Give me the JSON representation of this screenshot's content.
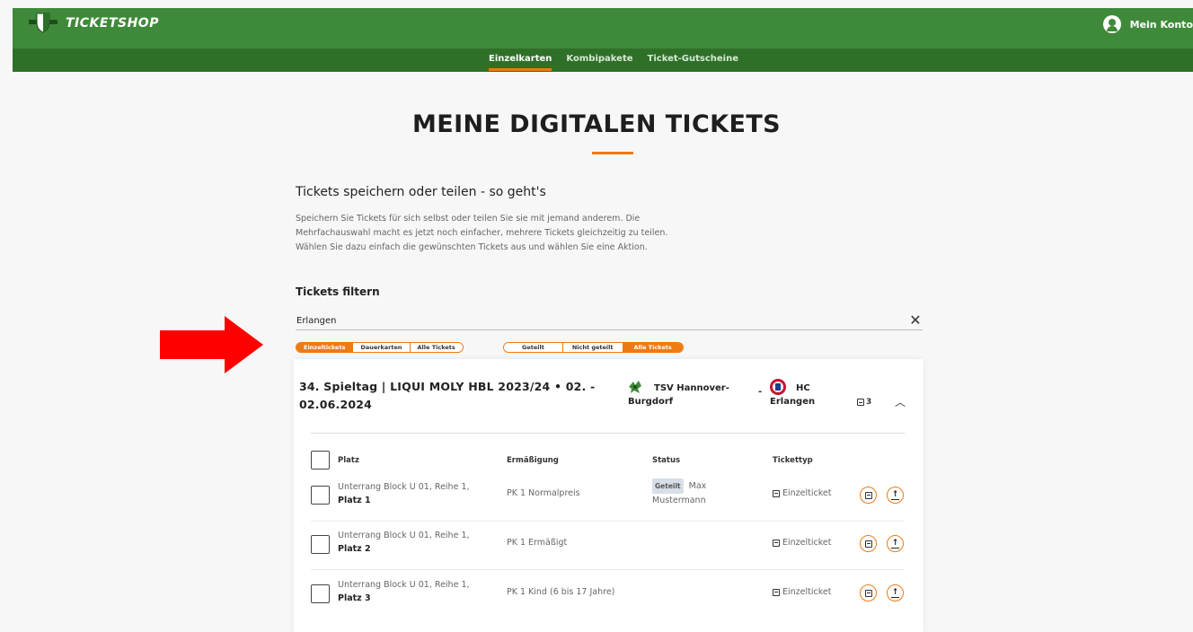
{
  "header": {
    "brand": "TICKETSHOP",
    "account_label": "Mein Konto"
  },
  "nav": [
    {
      "label": "Einzelkarten",
      "active": true
    },
    {
      "label": "Kombipakete",
      "active": false
    },
    {
      "label": "Ticket-Gutscheine",
      "active": false
    }
  ],
  "page": {
    "title": "MEINE DIGITALEN TICKETS"
  },
  "howto": {
    "title": "Tickets speichern oder teilen - so geht's",
    "text": "Speichern Sie Tickets für sich selbst oder teilen Sie sie mit jemand anderem. Die Mehrfachauswahl macht es jetzt noch einfacher, mehrere Tickets gleichzeitig zu teilen. Wählen Sie dazu einfach die gewünschten Tickets aus und wählen Sie eine Aktion."
  },
  "filter": {
    "title": "Tickets filtern",
    "search_value": "Erlangen",
    "type_chips": [
      {
        "label": "Einzeltickets",
        "active": true
      },
      {
        "label": "Dauerkarten",
        "active": false
      },
      {
        "label": "Alle Tickets",
        "active": false
      }
    ],
    "share_chips": [
      {
        "label": "Geteilt",
        "active": false
      },
      {
        "label": "Nicht geteilt",
        "active": false
      },
      {
        "label": "Alle Tickets",
        "active": true
      }
    ]
  },
  "event": {
    "title": "34. Spieltag | LIQUI MOLY HBL 2023/24 • 02. - 02.06.2024",
    "home_line1": "TSV Hannover-",
    "home_line2": "Burgdorf",
    "separator": "-",
    "away_line1": "HC",
    "away_line2": "Erlangen",
    "ticket_count": "3",
    "columns": {
      "seat": "Platz",
      "discount": "Ermäßigung",
      "status": "Status",
      "type": "Tickettyp"
    },
    "tickets": [
      {
        "seat_line": "Unterrang Block U 01, Reihe 1,",
        "seat_num": "Platz 1",
        "discount": "PK 1 Normalpreis",
        "status_badge": "Geteilt",
        "status_name_1": "Max",
        "status_name_2": "Mustermann",
        "type": "Einzelticket"
      },
      {
        "seat_line": "Unterrang Block U 01, Reihe 1,",
        "seat_num": "Platz 2",
        "discount": "PK 1 Ermäßigt",
        "status_badge": "",
        "status_name_1": "",
        "status_name_2": "",
        "type": "Einzelticket"
      },
      {
        "seat_line": "Unterrang Block U 01, Reihe 1,",
        "seat_num": "Platz 3",
        "discount": "PK 1 Kind (6 bis 17 Jahre)",
        "status_badge": "",
        "status_name_1": "",
        "status_name_2": "",
        "type": "Einzelticket"
      }
    ]
  },
  "colors": {
    "brand_green": "#3f8a3a",
    "nav_green": "#2f7029",
    "accent_orange": "#ee7a14",
    "arrow_red": "#ff0000"
  },
  "icons": [
    "shield-logo-icon",
    "account-icon",
    "close-icon",
    "ticket-icon",
    "chevron-up-icon",
    "share-icon",
    "arrow-icon"
  ]
}
